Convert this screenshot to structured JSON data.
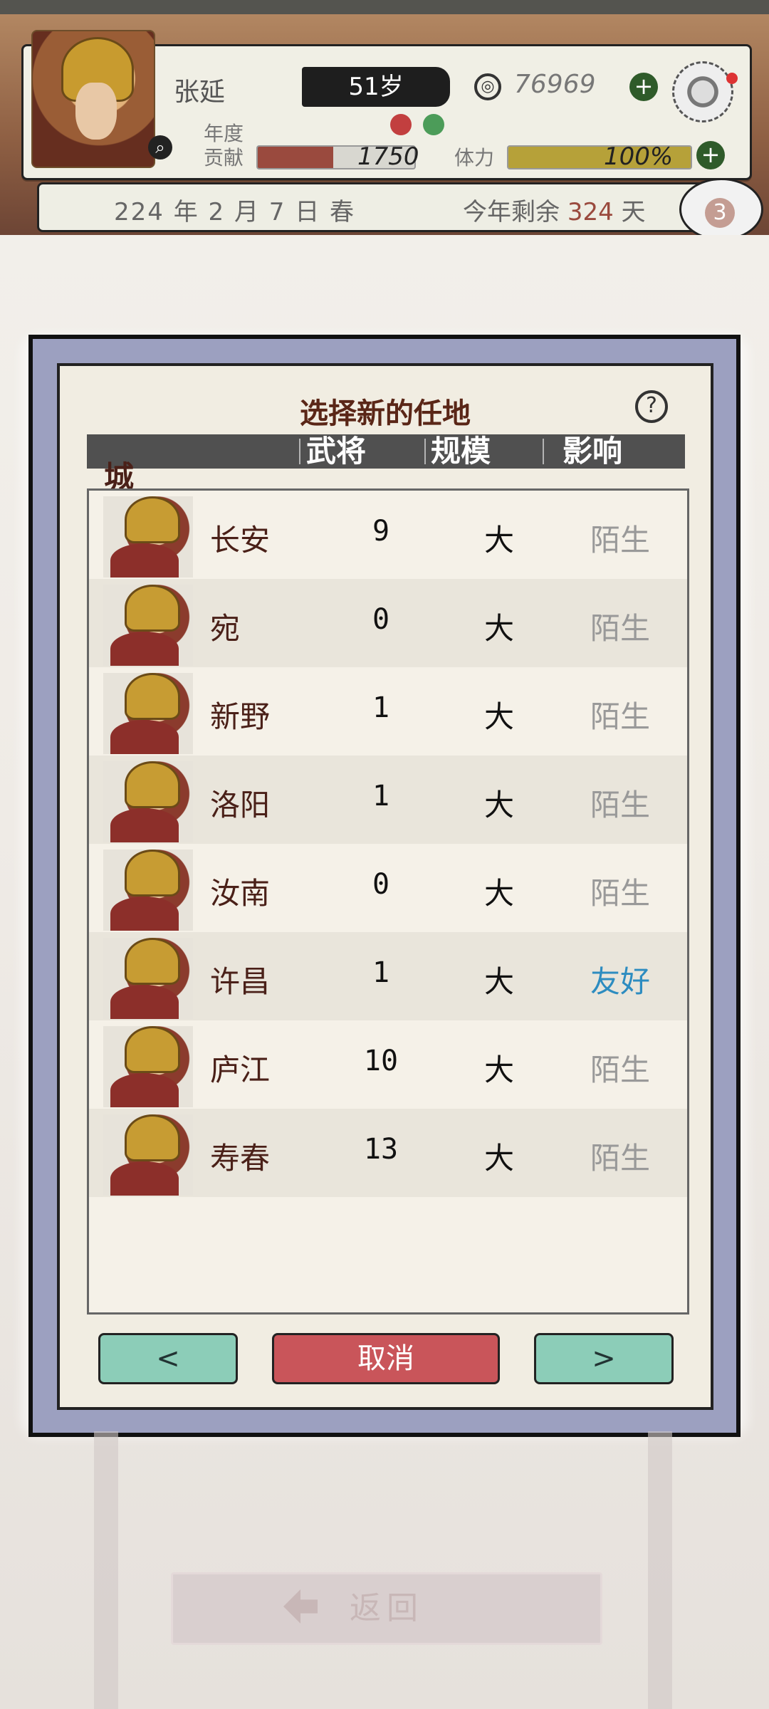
{
  "header": {
    "name": "张延",
    "age": "51岁",
    "coins": "76969",
    "annual_label": "年度",
    "contribution_label": "贡献",
    "contribution_value": "1750",
    "energy_label": "体力",
    "energy_value": "100%",
    "contribution_fraction": 0.48,
    "energy_fraction": 1.0
  },
  "date": {
    "text": "224 年 2 月 7 日 春",
    "remaining_prefix": "今年剩余",
    "remaining_days": "324",
    "remaining_suffix": "天",
    "notice_count": "3"
  },
  "dialog": {
    "title": "选择新的任地",
    "help": "?",
    "headers": [
      "城",
      "武将",
      "规模",
      "影响"
    ],
    "rows": [
      {
        "city": "长安",
        "generals": "9",
        "scale": "大",
        "influence": "陌生"
      },
      {
        "city": "宛",
        "generals": "0",
        "scale": "大",
        "influence": "陌生"
      },
      {
        "city": "新野",
        "generals": "1",
        "scale": "大",
        "influence": "陌生"
      },
      {
        "city": "洛阳",
        "generals": "1",
        "scale": "大",
        "influence": "陌生"
      },
      {
        "city": "汝南",
        "generals": "0",
        "scale": "大",
        "influence": "陌生"
      },
      {
        "city": "许昌",
        "generals": "1",
        "scale": "大",
        "influence": "友好"
      },
      {
        "city": "庐江",
        "generals": "10",
        "scale": "大",
        "influence": "陌生"
      },
      {
        "city": "寿春",
        "generals": "13",
        "scale": "大",
        "influence": "陌生"
      }
    ],
    "buttons": {
      "prev": "<",
      "cancel": "取消",
      "next": ">"
    }
  },
  "footer": {
    "back_label": "返回"
  },
  "colors": {
    "accent_red": "#c9555a",
    "teal_button": "#8ccdb8",
    "friendly_blue": "#2d8cc0"
  }
}
